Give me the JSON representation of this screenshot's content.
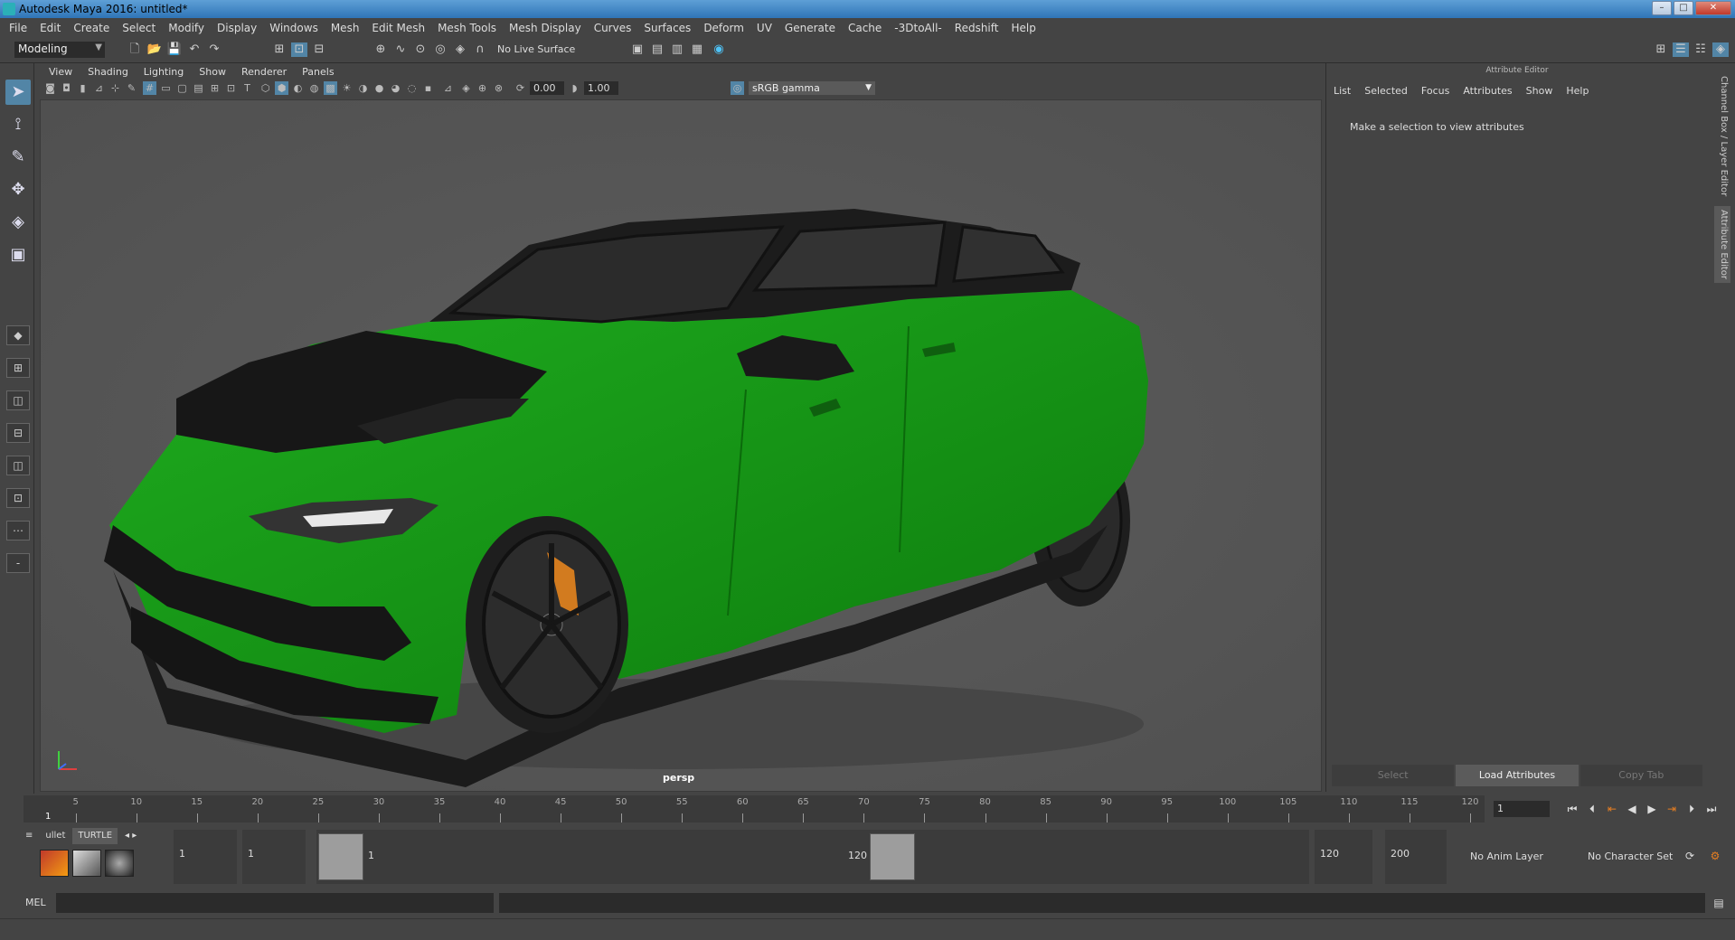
{
  "window": {
    "title": "Autodesk Maya 2016: untitled*"
  },
  "menubar": [
    "File",
    "Edit",
    "Create",
    "Select",
    "Modify",
    "Display",
    "Windows",
    "Mesh",
    "Edit Mesh",
    "Mesh Tools",
    "Mesh Display",
    "Curves",
    "Surfaces",
    "Deform",
    "UV",
    "Generate",
    "Cache",
    "-3DtoAll-",
    "Redshift",
    "Help"
  ],
  "status_line": {
    "mode": "Modeling",
    "live_surface": "No Live Surface"
  },
  "viewport": {
    "menu": [
      "View",
      "Shading",
      "Lighting",
      "Show",
      "Renderer",
      "Panels"
    ],
    "exposure": "0.00",
    "gamma": "1.00",
    "color_space": "sRGB gamma",
    "camera": "persp",
    "car_body_color": "#169c16"
  },
  "attribute_editor": {
    "title": "Attribute Editor",
    "menu": [
      "List",
      "Selected",
      "Focus",
      "Attributes",
      "Show",
      "Help"
    ],
    "message": "Make a selection to view attributes",
    "buttons": {
      "select": "Select",
      "load": "Load Attributes",
      "copy": "Copy Tab"
    }
  },
  "side_tabs": {
    "channel_box": "Channel Box / Layer Editor",
    "attribute_editor": "Attribute Editor"
  },
  "time_slider": {
    "ticks": [
      "5",
      "10",
      "15",
      "20",
      "25",
      "30",
      "35",
      "40",
      "45",
      "50",
      "55",
      "60",
      "65",
      "70",
      "75",
      "80",
      "85",
      "90",
      "95",
      "100",
      "105",
      "110",
      "115",
      "120"
    ],
    "current_frame_label": "1",
    "current_frame_field": "1"
  },
  "range_slider": {
    "shelf_tabs": [
      "ullet",
      "TURTLE"
    ],
    "start_field": "1",
    "playback_start": "1",
    "range_start_label": "1",
    "range_end_label": "120",
    "playback_end": "120",
    "end_field": "200",
    "anim_layer": "No Anim Layer",
    "character_set": "No Character Set"
  },
  "command_line": {
    "language": "MEL"
  },
  "accent": "#5285a6"
}
